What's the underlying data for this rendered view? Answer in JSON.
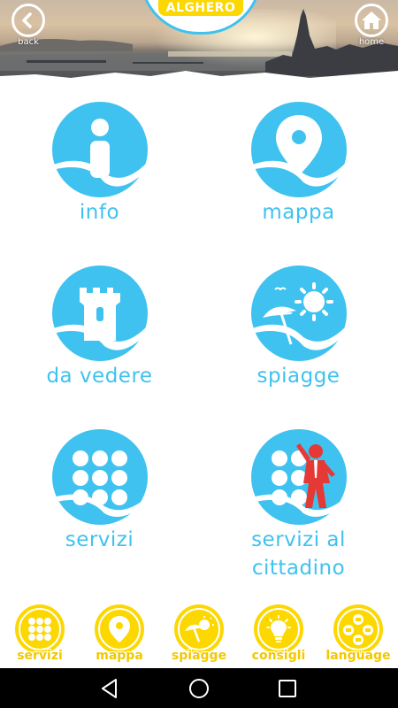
{
  "header": {
    "back_label": "back",
    "home_label": "home",
    "logo_text": "ALGHERO"
  },
  "grid": [
    {
      "label": "info",
      "icon": "info-icon"
    },
    {
      "label": "mappa",
      "icon": "map-pin-icon"
    },
    {
      "label": "da vedere",
      "icon": "tower-icon"
    },
    {
      "label": "spiagge",
      "icon": "beach-umbrella-icon"
    },
    {
      "label": "servizi",
      "icon": "dots-grid-icon"
    },
    {
      "label": "servizi al cittadino",
      "label_line1": "servizi al",
      "label_line2": "cittadino",
      "icon": "citizen-services-icon"
    }
  ],
  "bottom_nav": [
    {
      "label": "servizi",
      "icon": "dots-grid-icon"
    },
    {
      "label": "mappa",
      "icon": "map-pin-icon"
    },
    {
      "label": "spiagge",
      "icon": "beach-umbrella-icon"
    },
    {
      "label": "consigli",
      "icon": "lightbulb-icon"
    },
    {
      "label": "language",
      "icon": "flags-icon"
    }
  ],
  "system_nav": [
    "back-triangle-icon",
    "home-circle-icon",
    "recents-square-icon"
  ],
  "colors": {
    "accent_blue": "#3fc2ef",
    "accent_yellow": "#fcd700",
    "person_red": "#e53935"
  }
}
